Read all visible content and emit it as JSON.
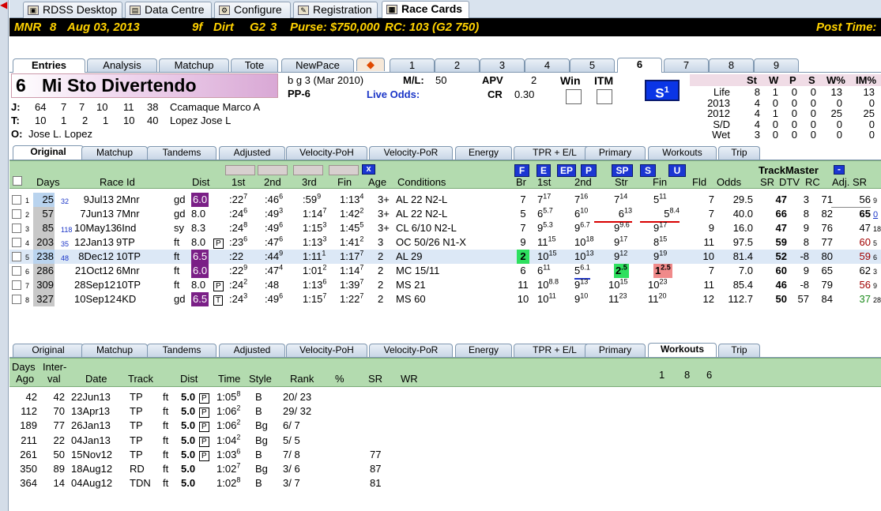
{
  "app_tabs": [
    "RDSS Desktop",
    "Data Centre",
    "Configure",
    "Registration",
    "Race Cards"
  ],
  "race_header": {
    "track": "MNR",
    "race": "8",
    "date": "Aug 03, 2013",
    "distance": "9f",
    "surface": "Dirt",
    "grade": "G2",
    "grade_num": "3",
    "purse": "Purse: $750,000",
    "rc": "RC: 103 (G2 750)",
    "post_time": "Post Time:"
  },
  "main_tabs": [
    "Entries",
    "Analysis",
    "Matchup",
    "Tote",
    "NewPace"
  ],
  "horse_tabs": [
    "1",
    "2",
    "3",
    "4",
    "5",
    "6",
    "7",
    "8",
    "9"
  ],
  "horse": {
    "pp_number": "6",
    "name": "Mi Sto Divertendo",
    "desc": "b g 3  (Mar 2010)",
    "pp": "PP-6",
    "ml_label": "M/L:",
    "ml": "50",
    "live_odds": "Live Odds:",
    "apv_label": "APV",
    "apv": "2",
    "cr_label": "CR",
    "cr": "0.30",
    "win": "Win",
    "itm": "ITM",
    "s_badge": "S",
    "s_badge_num": "1"
  },
  "connections": [
    {
      "label": "J:",
      "stats": [
        "64",
        "7",
        "7",
        "10",
        "11",
        "38"
      ],
      "name": "Ccamaque Marco A"
    },
    {
      "label": "T:",
      "stats": [
        "10",
        "1",
        "2",
        "1",
        "10",
        "40"
      ],
      "name": "Lopez Jose L"
    },
    {
      "label": "O:",
      "name": "Jose L. Lopez"
    }
  ],
  "stats_table": {
    "headers": [
      "St",
      "W",
      "P",
      "S",
      "W%",
      "IM%"
    ],
    "rows": [
      {
        "label": "Life",
        "vals": [
          "8",
          "1",
          "0",
          "0",
          "13",
          "13"
        ]
      },
      {
        "label": "2013",
        "vals": [
          "4",
          "0",
          "0",
          "0",
          "0",
          "0"
        ]
      },
      {
        "label": "2012",
        "vals": [
          "4",
          "1",
          "0",
          "0",
          "25",
          "25"
        ]
      },
      {
        "label": "S/D",
        "vals": [
          "4",
          "0",
          "0",
          "0",
          "0",
          "0"
        ]
      },
      {
        "label": "Wet",
        "vals": [
          "3",
          "0",
          "0",
          "0",
          "0",
          "0"
        ]
      }
    ]
  },
  "sub_tabs": [
    "Original",
    "Matchup",
    "Tandems",
    "Adjusted",
    "Velocity-PoH",
    "Velocity-PoR",
    "Energy",
    "TPR + E/L",
    "Primary",
    "Workouts",
    "Trip"
  ],
  "pp_headers": {
    "days": "Days",
    "race_id": "Race Id",
    "dist": "Dist",
    "c1": "1st",
    "c2": "2nd",
    "c3": "3rd",
    "fin": "Fin",
    "age": "Age",
    "conditions": "Conditions",
    "br": "Br",
    "first": "1st",
    "second": "2nd",
    "str": "Str",
    "fin2": "Fin",
    "fld": "Fld",
    "odds": "Odds",
    "sr": "SR",
    "dtv": "DTV",
    "rc": "RC",
    "adj_sr": "Adj. SR",
    "trackmaster": "TrackMaster",
    "filter_x": "x"
  },
  "pace_buttons": [
    "F",
    "E",
    "EP",
    "P",
    "SP",
    "S",
    "U"
  ],
  "pp_rows": [
    {
      "n": "1",
      "days": "25",
      "gap": "32",
      "date": "9Jul13",
      "rid": "2Mnr",
      "cond": "gd",
      "dist": "6.0",
      "dh": true,
      "c1": ":22",
      "c1s": "7",
      "c2": ":46",
      "c2s": "6",
      "c3": ":59",
      "c3s": "9",
      "fin": "1:13",
      "fins": "4",
      "age": "3+",
      "cnd": "AL 22 N2-L",
      "br": "7",
      "f1": "7",
      "f1s": "17",
      "f2": "7",
      "f2s": "16",
      "str": "7",
      "strs": "14",
      "fn": "5",
      "fns": "11",
      "fld": "7",
      "odds": "29.5",
      "sr": "47",
      "dtv": "3",
      "rc": "71",
      "adj": "56",
      "adjs": "9"
    },
    {
      "n": "2",
      "days": "57",
      "gap": "",
      "date": "7Jun13",
      "rid": "7Mnr",
      "cond": "gd",
      "dist": "8.0",
      "c1": ":24",
      "c1s": "6",
      "c2": ":49",
      "c2s": "3",
      "c3": "1:14",
      "c3s": "7",
      "fin": "1:42",
      "fins": "2",
      "age": "3+",
      "cnd": "AL 22 N2-L",
      "br": "5",
      "f1": "6",
      "f1s": "5.7",
      "f2": "6",
      "f2s": "10",
      "str": "6",
      "strs": "13",
      "fn": "5",
      "fns": "8.4",
      "fld": "7",
      "odds": "40.0",
      "sr": "66",
      "dtv": "8",
      "rc": "82",
      "adj": "65",
      "adjs": "0"
    },
    {
      "n": "3",
      "days": "85",
      "gap": "118",
      "date": "10May13",
      "rid": "6Ind",
      "cond": "sy",
      "dist": "8.3",
      "c1": ":24",
      "c1s": "8",
      "c2": ":49",
      "c2s": "6",
      "c3": "1:15",
      "c3s": "3",
      "fin": "1:45",
      "fins": "5",
      "age": "3+",
      "cnd": "CL 6/10 N2-L",
      "br": "7",
      "f1": "9",
      "f1s": "5.3",
      "f2": "9",
      "f2s": "6.7",
      "str": "9",
      "strs": "9.6",
      "fn": "9",
      "fns": "17",
      "fld": "9",
      "odds": "16.0",
      "sr": "47",
      "dtv": "9",
      "rc": "76",
      "adj": "47",
      "adjs": "18"
    },
    {
      "n": "4",
      "days": "203",
      "gap": "35",
      "date": "12Jan13",
      "rid": "9TP",
      "cond": "ft",
      "dist": "8.0",
      "box": "P",
      "c1": ":23",
      "c1s": "6",
      "c2": ":47",
      "c2s": "6",
      "c3": "1:13",
      "c3s": "3",
      "fin": "1:41",
      "fins": "2",
      "age": "3",
      "cnd": "OC 50/26 N1-X",
      "br": "9",
      "f1": "11",
      "f1s": "15",
      "f2": "10",
      "f2s": "18",
      "str": "9",
      "strs": "17",
      "fn": "8",
      "fns": "15",
      "fld": "11",
      "odds": "97.5",
      "sr": "59",
      "dtv": "8",
      "rc": "77",
      "adj": "60",
      "adjs": "5"
    },
    {
      "n": "5",
      "days": "238",
      "gap": "48",
      "date": "8Dec12",
      "rid": "10TP",
      "cond": "ft",
      "dist": "6.5",
      "dh": true,
      "c1": ":22",
      "c1s": "",
      "c2": ":44",
      "c2s": "9",
      "c3": "1:11",
      "c3s": "1",
      "fin": "1:17",
      "fins": "7",
      "age": "2",
      "cnd": "AL 29",
      "br": "2",
      "f1": "10",
      "f1s": "15",
      "f2": "10",
      "f2s": "13",
      "str": "9",
      "strs": "12",
      "fn": "9",
      "fns": "19",
      "fld": "10",
      "odds": "81.4",
      "sr": "52",
      "dtv": "-8",
      "rc": "80",
      "adj": "59",
      "adjs": "6"
    },
    {
      "n": "6",
      "days": "286",
      "gap": "",
      "date": "21Oct12",
      "rid": "6Mnr",
      "cond": "ft",
      "dist": "6.0",
      "dh": true,
      "c1": ":22",
      "c1s": "9",
      "c2": ":47",
      "c2s": "4",
      "c3": "1:01",
      "c3s": "2",
      "fin": "1:14",
      "fins": "7",
      "age": "2",
      "cnd": "MC 15/11",
      "br": "6",
      "f1": "6",
      "f1s": "11",
      "f2": "5",
      "f2s": "6.1",
      "str": "2",
      "strs": ".5",
      "fn": "1",
      "fns": "2.5",
      "fld": "7",
      "odds": "7.0",
      "sr": "60",
      "dtv": "9",
      "rc": "65",
      "adj": "62",
      "adjs": "3"
    },
    {
      "n": "7",
      "days": "309",
      "gap": "",
      "date": "28Sep12",
      "rid": "10TP",
      "cond": "ft",
      "dist": "8.0",
      "box": "P",
      "c1": ":24",
      "c1s": "2",
      "c2": ":48",
      "c2s": "",
      "c3": "1:13",
      "c3s": "6",
      "fin": "1:39",
      "fins": "7",
      "age": "2",
      "cnd": "MS 21",
      "br": "11",
      "f1": "10",
      "f1s": "8.8",
      "f2": "9",
      "f2s": "13",
      "str": "10",
      "strs": "15",
      "fn": "10",
      "fns": "23",
      "fld": "11",
      "odds": "85.4",
      "sr": "46",
      "dtv": "-8",
      "rc": "79",
      "adj": "56",
      "adjs": "9"
    },
    {
      "n": "8",
      "days": "327",
      "gap": "",
      "date": "10Sep12",
      "rid": "4KD",
      "cond": "gd",
      "dist": "6.5",
      "dh": true,
      "box": "T",
      "c1": ":24",
      "c1s": "3",
      "c2": ":49",
      "c2s": "6",
      "c3": "1:15",
      "c3s": "7",
      "fin": "1:22",
      "fins": "7",
      "age": "2",
      "cnd": "MS 60",
      "br": "10",
      "f1": "10",
      "f1s": "11",
      "f2": "9",
      "f2s": "10",
      "str": "11",
      "strs": "23",
      "fn": "11",
      "fns": "20",
      "fld": "12",
      "odds": "112.7",
      "sr": "50",
      "dtv": "57",
      "rc": "84",
      "adj": "37",
      "adjs": "28"
    }
  ],
  "workouts": {
    "headers": {
      "days": "Days",
      "ago": "Ago",
      "inter": "Inter-",
      "val": "val",
      "date": "Date",
      "track": "Track",
      "dist": "Dist",
      "time": "Time",
      "style": "Style",
      "rank": "Rank",
      "pct": "%",
      "sr": "SR",
      "wr": "WR"
    },
    "marks": [
      "1",
      "8",
      "6"
    ],
    "rows": [
      {
        "ago": "42",
        "iv": "42",
        "date": "22Jun13",
        "track": "TP",
        "cond": "ft",
        "dist": "5.0",
        "box": "P",
        "time": "1:05",
        "ts": "8",
        "style": "B",
        "rank": "20/ 23",
        "sr": ""
      },
      {
        "ago": "112",
        "iv": "70",
        "date": "13Apr13",
        "track": "TP",
        "cond": "ft",
        "dist": "5.0",
        "box": "P",
        "time": "1:06",
        "ts": "2",
        "style": "B",
        "rank": "29/ 32",
        "sr": ""
      },
      {
        "ago": "189",
        "iv": "77",
        "date": "26Jan13",
        "track": "TP",
        "cond": "ft",
        "dist": "5.0",
        "box": "P",
        "time": "1:06",
        "ts": "2",
        "style": "Bg",
        "rank": "6/ 7",
        "sr": ""
      },
      {
        "ago": "211",
        "iv": "22",
        "date": "04Jan13",
        "track": "TP",
        "cond": "ft",
        "dist": "5.0",
        "box": "P",
        "time": "1:04",
        "ts": "2",
        "style": "Bg",
        "rank": "5/ 5",
        "sr": ""
      },
      {
        "ago": "261",
        "iv": "50",
        "date": "15Nov12",
        "track": "TP",
        "cond": "ft",
        "dist": "5.0",
        "box": "P",
        "time": "1:03",
        "ts": "6",
        "style": "B",
        "rank": "7/ 8",
        "sr": "77"
      },
      {
        "ago": "350",
        "iv": "89",
        "date": "18Aug12",
        "track": "RD",
        "cond": "ft",
        "dist": "5.0",
        "box": "",
        "time": "1:02",
        "ts": "7",
        "style": "Bg",
        "rank": "3/ 6",
        "sr": "87"
      },
      {
        "ago": "364",
        "iv": "14",
        "date": "04Aug12",
        "track": "TDN",
        "cond": "ft",
        "dist": "5.0",
        "box": "",
        "time": "1:02",
        "ts": "8",
        "style": "B",
        "rank": "3/ 7",
        "sr": "81"
      }
    ]
  }
}
